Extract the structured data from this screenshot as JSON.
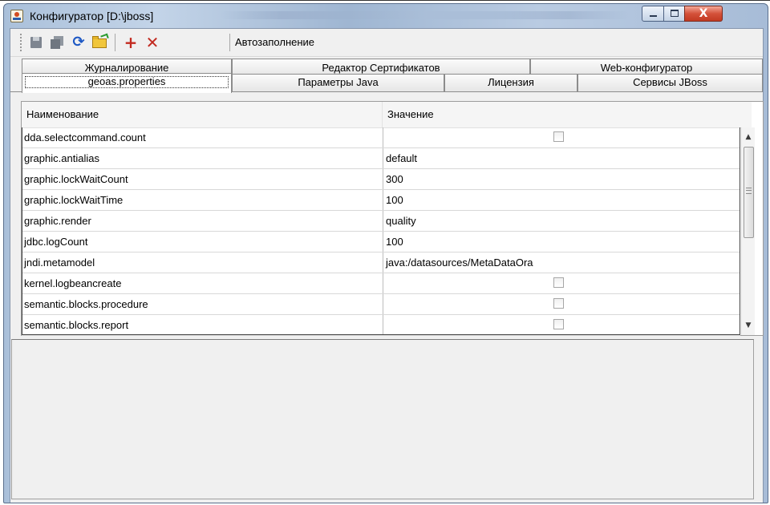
{
  "window": {
    "title": "Конфигуратор [D:\\jboss]",
    "controls": {
      "close_label": "X"
    }
  },
  "toolbar": {
    "buttons": [
      "save-icon",
      "save-all-icon",
      "refresh-icon",
      "open-folder-icon",
      "add-icon",
      "delete-icon"
    ],
    "autofill_label": "Автозаполнение"
  },
  "tabs": {
    "row1": [
      "Журналирование",
      "Редактор Сертификатов",
      "Web-конфигуратор"
    ],
    "row2": [
      "geoas.properties",
      "Параметры Java",
      "Лицензия",
      "Сервисы JBoss"
    ],
    "active": "geoas.properties"
  },
  "table": {
    "columns": [
      "Наименование",
      "Значение"
    ],
    "rows": [
      {
        "name": "dda.selectcommand.count",
        "value": "",
        "checkbox": true,
        "checked": false
      },
      {
        "name": "graphic.antialias",
        "value": "default",
        "checkbox": false
      },
      {
        "name": "graphic.lockWaitCount",
        "value": "300",
        "checkbox": false
      },
      {
        "name": "graphic.lockWaitTime",
        "value": "100",
        "checkbox": false
      },
      {
        "name": "graphic.render",
        "value": "quality",
        "checkbox": false
      },
      {
        "name": "jdbc.logCount",
        "value": "100",
        "checkbox": false
      },
      {
        "name": "jndi.metamodel",
        "value": "java:/datasources/MetaDataOra",
        "checkbox": false
      },
      {
        "name": "kernel.logbeancreate",
        "value": "",
        "checkbox": true,
        "checked": false
      },
      {
        "name": "semantic.blocks.procedure",
        "value": "",
        "checkbox": true,
        "checked": false
      },
      {
        "name": "semantic.blocks.report",
        "value": "",
        "checkbox": true,
        "checked": false
      }
    ]
  },
  "colors": {
    "title_bar": "#b9cbe2",
    "close_button": "#c9452d",
    "accent_icon": "#c22a20"
  }
}
